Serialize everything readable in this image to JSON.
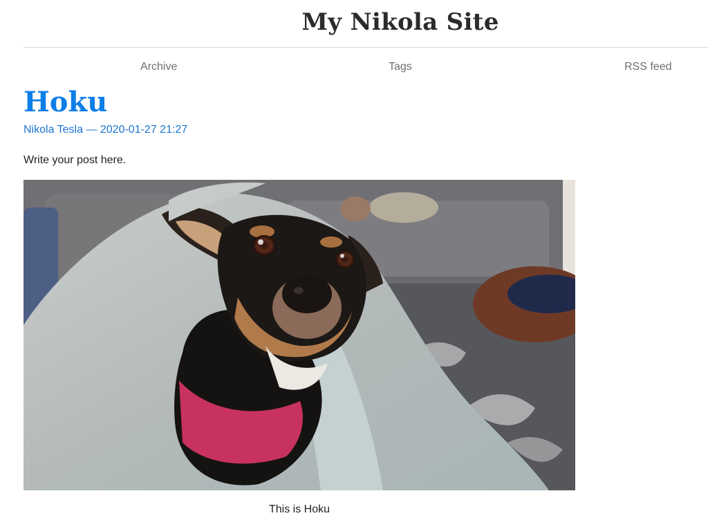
{
  "site": {
    "title": "My Nikola Site"
  },
  "nav": {
    "items": [
      {
        "label": "Archive"
      },
      {
        "label": "Tags"
      },
      {
        "label": "RSS feed"
      }
    ]
  },
  "post": {
    "title": "Hoku",
    "author": "Nikola Tesla",
    "separator": "—",
    "date": "2020-01-27 21:27",
    "body": "Write your post here.",
    "image": {
      "icon": "dog-photo",
      "caption": "This is Hoku"
    }
  },
  "colors": {
    "link": "#1a73d1",
    "title": "#0d7ee8",
    "nav": "#6e6e6e",
    "border": "#d6d6d6"
  }
}
